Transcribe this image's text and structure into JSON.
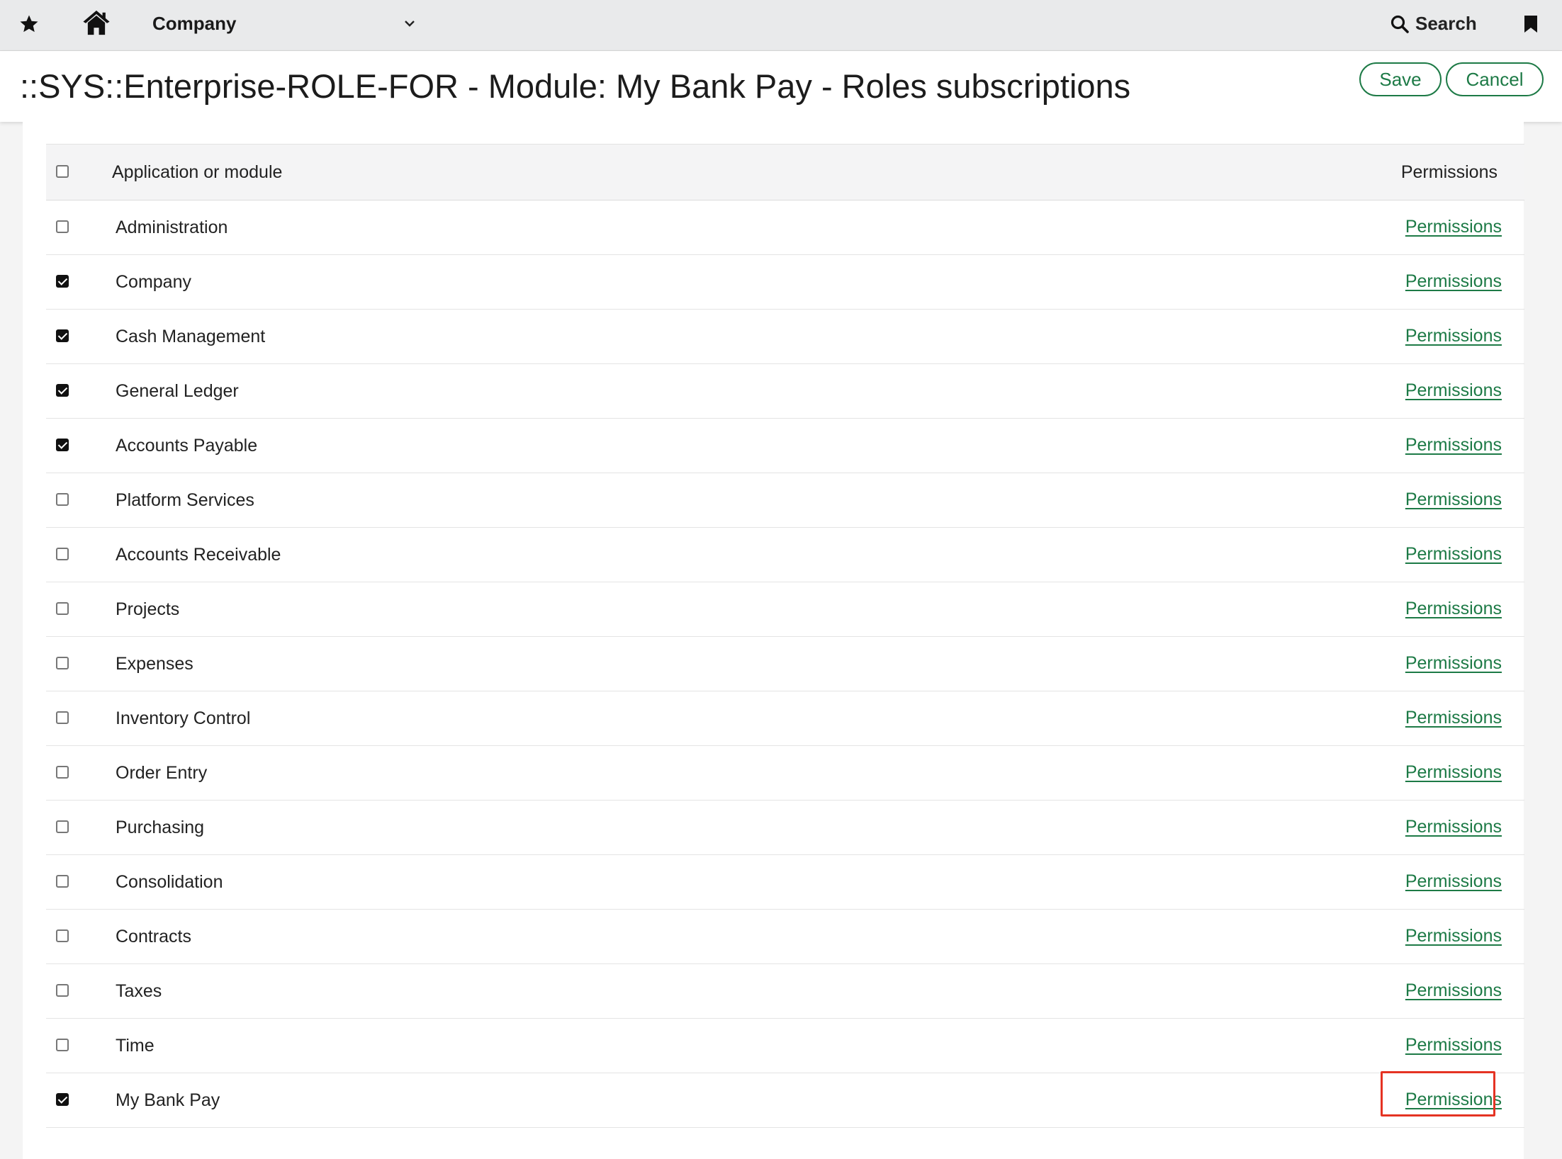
{
  "topbar": {
    "menu_label": "Company",
    "search_label": "Search"
  },
  "header": {
    "title": "::SYS::Enterprise-ROLE-FOR - Module: My Bank Pay - Roles subscriptions",
    "save_label": "Save",
    "cancel_label": "Cancel"
  },
  "table": {
    "columns": [
      "Application or module",
      "Permissions"
    ],
    "link_label": "Permissions",
    "rows": [
      {
        "name": "Administration",
        "checked": false
      },
      {
        "name": "Company",
        "checked": true
      },
      {
        "name": "Cash Management",
        "checked": true
      },
      {
        "name": "General Ledger",
        "checked": true
      },
      {
        "name": "Accounts Payable",
        "checked": true
      },
      {
        "name": "Platform Services",
        "checked": false
      },
      {
        "name": "Accounts Receivable",
        "checked": false
      },
      {
        "name": "Projects",
        "checked": false
      },
      {
        "name": "Expenses",
        "checked": false
      },
      {
        "name": "Inventory Control",
        "checked": false
      },
      {
        "name": "Order Entry",
        "checked": false
      },
      {
        "name": "Purchasing",
        "checked": false
      },
      {
        "name": "Consolidation",
        "checked": false
      },
      {
        "name": "Contracts",
        "checked": false
      },
      {
        "name": "Taxes",
        "checked": false
      },
      {
        "name": "Time",
        "checked": false
      },
      {
        "name": "My Bank Pay",
        "checked": true
      }
    ]
  },
  "colors": {
    "accent": "#1d7a46",
    "highlight": "#e53323"
  }
}
